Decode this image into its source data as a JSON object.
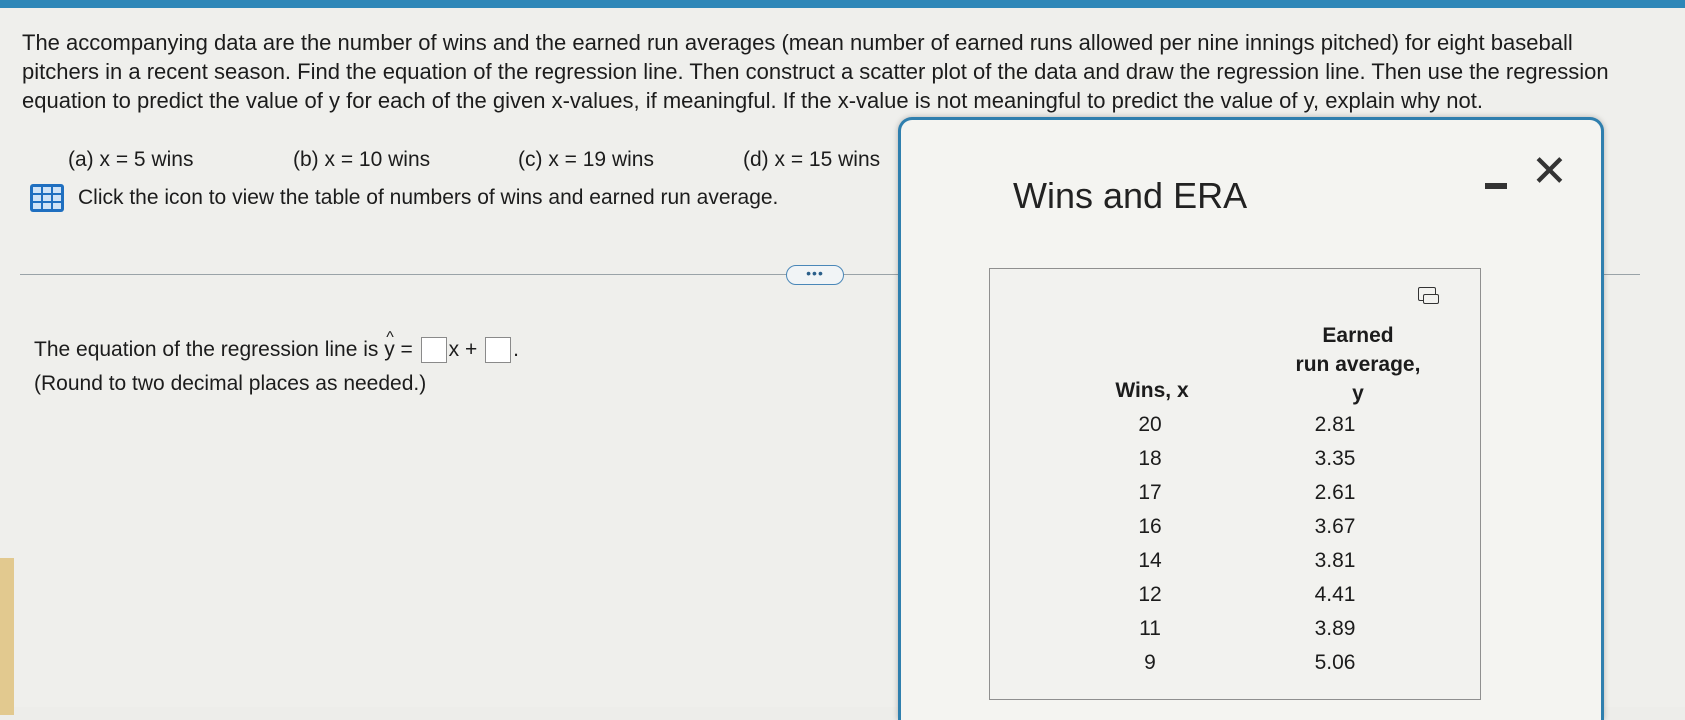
{
  "question": {
    "text": "The accompanying data are the number of wins and the earned run averages (mean number of earned runs allowed per nine innings pitched) for eight baseball pitchers in a recent season. Find the equation of the regression line. Then construct a scatter plot of the data and draw the regression line. Then use the regression equation to predict the value of y for each of the given x-values, if meaningful. If the x-value is not meaningful to predict the value of y, explain why not.",
    "parts": [
      "(a) x = 5 wins",
      "(b) x = 10 wins",
      "(c) x = 19 wins",
      "(d) x = 15 wins"
    ],
    "table_link": "Click the icon to view the table of numbers of wins and earned run average."
  },
  "more_button": "•••",
  "answer": {
    "prefix": "The equation of the regression line is ",
    "y_hat": "y",
    "equals": " = ",
    "x_plus": "x + ",
    "period": ".",
    "note": "(Round to two decimal places as needed.)"
  },
  "popup": {
    "title": "Wins and ERA",
    "close_glyph": "✕",
    "headers": {
      "wins": "Wins, x",
      "era_line1": "Earned",
      "era_line2": "run average,",
      "era_line3": "y"
    },
    "rows": [
      {
        "x": "20",
        "y": "2.81"
      },
      {
        "x": "18",
        "y": "3.35"
      },
      {
        "x": "17",
        "y": "2.61"
      },
      {
        "x": "16",
        "y": "3.67"
      },
      {
        "x": "14",
        "y": "3.81"
      },
      {
        "x": "12",
        "y": "4.41"
      },
      {
        "x": "11",
        "y": "3.89"
      },
      {
        "x": "9",
        "y": "5.06"
      }
    ]
  }
}
